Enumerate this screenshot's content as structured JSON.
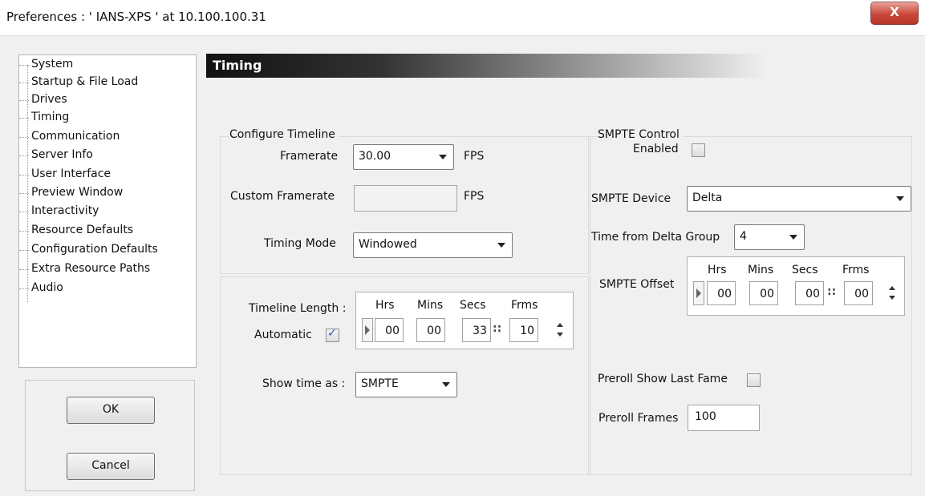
{
  "window": {
    "title": "Preferences  :  ' IANS-XPS '  at  10.100.100.31",
    "close_label": "X"
  },
  "nav": {
    "items": [
      {
        "label": "System"
      },
      {
        "label": "Startup & File Load"
      },
      {
        "label": "Drives"
      },
      {
        "label": "Timing"
      },
      {
        "label": "Communication"
      },
      {
        "label": "Server Info"
      },
      {
        "label": "User Interface"
      },
      {
        "label": "Preview Window"
      },
      {
        "label": "Interactivity"
      },
      {
        "label": "Resource Defaults"
      },
      {
        "label": "Configuration Defaults"
      },
      {
        "label": "Extra Resource Paths"
      },
      {
        "label": "Audio"
      }
    ]
  },
  "buttons": {
    "ok": "OK",
    "cancel": "Cancel"
  },
  "page_title": "Timing",
  "configure": {
    "group_label": "Configure Timeline",
    "framerate_label": "Framerate",
    "framerate_value": "30.00",
    "framerate_unit": "FPS",
    "custom_label": "Custom Framerate",
    "custom_value": "",
    "custom_unit": "FPS",
    "timing_mode_label": "Timing Mode",
    "timing_mode_value": "Windowed"
  },
  "timeline": {
    "length_label": "Timeline Length :",
    "automatic_label": "Automatic",
    "automatic_checked": true,
    "headers": [
      "Hrs",
      "Mins",
      "Secs",
      "Frms"
    ],
    "values": [
      "00",
      "00",
      "33",
      "10"
    ],
    "show_time_label": "Show time as :",
    "show_time_value": "SMPTE"
  },
  "smpte": {
    "group_label": "SMPTE Control",
    "enabled_label": "Enabled",
    "enabled_checked": false,
    "device_label": "SMPTE Device",
    "device_value": "Delta",
    "delta_group_label": "Time from Delta Group",
    "delta_group_value": "4",
    "offset_label": "SMPTE Offset",
    "headers": [
      "Hrs",
      "Mins",
      "Secs",
      "Frms"
    ],
    "values": [
      "00",
      "00",
      "00",
      "00"
    ],
    "preroll_last_label": "Preroll Show Last Fame",
    "preroll_last_checked": false,
    "preroll_frames_label": "Preroll Frames",
    "preroll_frames_value": "100"
  },
  "separators": {
    "colon_pair": "::"
  },
  "colors": {
    "header_dark": "#111111",
    "check_blue": "#2a5bb8",
    "close_red": "#c9483a"
  }
}
